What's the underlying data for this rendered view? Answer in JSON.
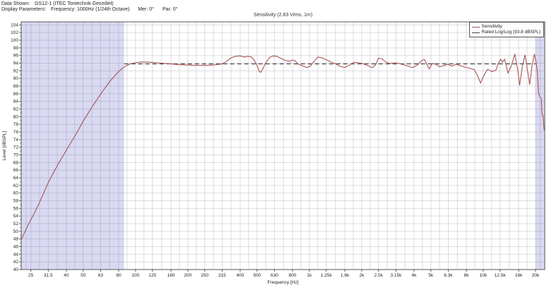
{
  "header": {
    "data_shown_label": "Data Shown:",
    "data_shown_value": "GS12-1 (ITEC Tontechnik GesmbH)",
    "display_parameters_label": "Display Parameters:",
    "display_parameters_value": "Frequency: 1000Hz (1/24th Octave)",
    "mer_value": "Mer: 0°",
    "par_value": "Par: 0°"
  },
  "chart_data": {
    "type": "line",
    "title": "Sensitivity (2.83 Vrms, 1m)",
    "xlabel": "Frequency [Hz]",
    "ylabel": "Level [dBSPL]",
    "x_scale": "log",
    "xlim": [
      22,
      22600
    ],
    "ylim": [
      40,
      104.8
    ],
    "y_tick_min": 40,
    "y_tick_max": 104,
    "y_tick_step": 2,
    "x_tick_values": [
      25,
      31.5,
      40,
      50,
      63,
      80,
      100,
      125,
      160,
      200,
      250,
      315,
      400,
      500,
      630,
      800,
      1000,
      1250,
      1600,
      2000,
      2500,
      3150,
      4000,
      5000,
      6300,
      8000,
      10000,
      12500,
      16000,
      20000
    ],
    "x_tick_labels": [
      "25",
      "31.5",
      "40",
      "50",
      "63",
      "80",
      "100",
      "125",
      "160",
      "200",
      "250",
      "315",
      "400",
      "500",
      "630",
      "800",
      "1k",
      "1.25k",
      "1.6k",
      "2k",
      "2.5k",
      "3.15k",
      "4k",
      "5k",
      "6.3k",
      "8k",
      "10k",
      "12.5k",
      "16k",
      "20k"
    ],
    "grid": true,
    "legend_position": "top-right",
    "shaded_band_color": "#d9d9f1",
    "shaded_bands": [
      [
        22,
        86
      ],
      [
        20000,
        22600
      ]
    ],
    "colors": {
      "plot_frame": "#555555",
      "grid_line": "rgba(100,100,135,0.22)",
      "text": "#222222"
    },
    "series": [
      {
        "name": "Sensitivity",
        "color": "#a85454",
        "dashed": false,
        "points": [
          [
            22,
            47.8
          ],
          [
            24,
            51.5
          ],
          [
            26,
            54.5
          ],
          [
            28,
            57.5
          ],
          [
            31.5,
            62.8
          ],
          [
            35.5,
            67.2
          ],
          [
            40,
            71.2
          ],
          [
            45,
            75.1
          ],
          [
            50,
            78.8
          ],
          [
            56,
            82.4
          ],
          [
            63,
            85.9
          ],
          [
            71,
            89.2
          ],
          [
            80,
            91.8
          ],
          [
            86,
            93.0
          ],
          [
            93,
            93.8
          ],
          [
            100,
            94.1
          ],
          [
            107,
            94.3
          ],
          [
            115,
            94.3
          ],
          [
            125,
            94.2
          ],
          [
            140,
            94.0
          ],
          [
            160,
            93.8
          ],
          [
            180,
            93.6
          ],
          [
            200,
            93.5
          ],
          [
            225,
            93.4
          ],
          [
            250,
            93.4
          ],
          [
            280,
            93.5
          ],
          [
            315,
            93.8
          ],
          [
            335,
            94.5
          ],
          [
            355,
            95.4
          ],
          [
            375,
            95.8
          ],
          [
            400,
            95.9
          ],
          [
            420,
            95.6
          ],
          [
            445,
            95.8
          ],
          [
            465,
            95.6
          ],
          [
            480,
            94.9
          ],
          [
            500,
            93.4
          ],
          [
            515,
            91.8
          ],
          [
            525,
            91.6
          ],
          [
            540,
            92.5
          ],
          [
            560,
            94.1
          ],
          [
            590,
            95.5
          ],
          [
            620,
            95.9
          ],
          [
            650,
            95.8
          ],
          [
            690,
            95.2
          ],
          [
            730,
            94.7
          ],
          [
            770,
            94.5
          ],
          [
            800,
            94.8
          ],
          [
            830,
            94.6
          ],
          [
            860,
            93.8
          ],
          [
            920,
            93.2
          ],
          [
            970,
            92.9
          ],
          [
            1010,
            93.2
          ],
          [
            1060,
            94.4
          ],
          [
            1120,
            95.6
          ],
          [
            1180,
            95.4
          ],
          [
            1250,
            94.9
          ],
          [
            1330,
            94.3
          ],
          [
            1420,
            93.8
          ],
          [
            1510,
            93.1
          ],
          [
            1600,
            92.9
          ],
          [
            1700,
            93.5
          ],
          [
            1800,
            94.2
          ],
          [
            1920,
            94.1
          ],
          [
            2050,
            93.8
          ],
          [
            2180,
            93.3
          ],
          [
            2300,
            92.8
          ],
          [
            2400,
            93.5
          ],
          [
            2500,
            95.3
          ],
          [
            2620,
            95.1
          ],
          [
            2750,
            94.3
          ],
          [
            2900,
            93.9
          ],
          [
            3100,
            94.1
          ],
          [
            3300,
            93.9
          ],
          [
            3550,
            93.5
          ],
          [
            3800,
            93.0
          ],
          [
            3950,
            92.9
          ],
          [
            4200,
            93.6
          ],
          [
            4450,
            94.8
          ],
          [
            4600,
            94.9
          ],
          [
            4800,
            93.2
          ],
          [
            4900,
            92.5
          ],
          [
            5100,
            93.9
          ],
          [
            5350,
            93.7
          ],
          [
            5600,
            93.1
          ],
          [
            5900,
            93.3
          ],
          [
            6250,
            93.7
          ],
          [
            6600,
            93.2
          ],
          [
            7000,
            93.7
          ],
          [
            7400,
            93.3
          ],
          [
            7800,
            93.0
          ],
          [
            8300,
            92.7
          ],
          [
            8900,
            92.3
          ],
          [
            9300,
            90.6
          ],
          [
            9650,
            88.8
          ],
          [
            10100,
            90.8
          ],
          [
            10600,
            92.4
          ],
          [
            11200,
            91.8
          ],
          [
            11800,
            92.1
          ],
          [
            12300,
            94.2
          ],
          [
            12600,
            95.0
          ],
          [
            12900,
            94.3
          ],
          [
            13300,
            95.0
          ],
          [
            13900,
            91.4
          ],
          [
            14600,
            93.6
          ],
          [
            15200,
            96.4
          ],
          [
            15800,
            92.2
          ],
          [
            16200,
            88.2
          ],
          [
            16800,
            93.2
          ],
          [
            17400,
            96.2
          ],
          [
            18000,
            92.0
          ],
          [
            18500,
            88.4
          ],
          [
            19100,
            93.2
          ],
          [
            19700,
            96.4
          ],
          [
            20200,
            94.0
          ],
          [
            20500,
            91.5
          ],
          [
            20800,
            86.2
          ],
          [
            21200,
            85.2
          ],
          [
            21600,
            84.8
          ],
          [
            21800,
            80.6
          ],
          [
            22100,
            80.3
          ],
          [
            22400,
            76.5
          ]
        ]
      },
      {
        "name": "Rated Log/Log (93.8 dBSPL)",
        "color": "#444444",
        "dashed": true,
        "points": [
          [
            86,
            93.8
          ],
          [
            20000,
            93.8
          ]
        ]
      }
    ]
  }
}
